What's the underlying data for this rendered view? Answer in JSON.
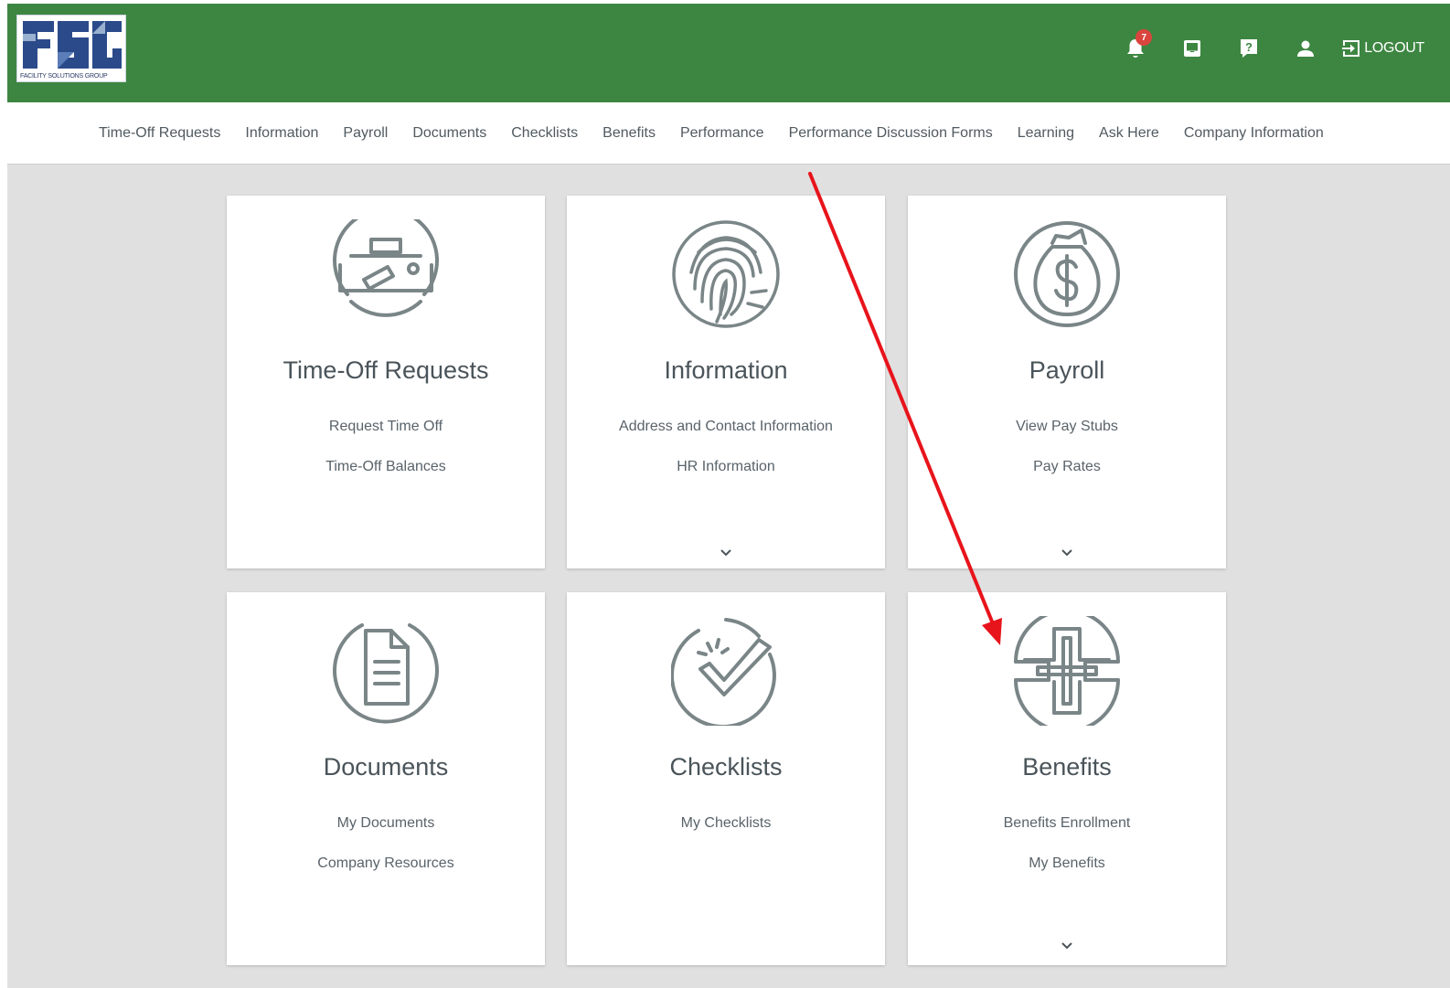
{
  "brand": {
    "logo_text": "FSG",
    "logo_caption": "FACILITY SOLUTIONS GROUP",
    "header_color": "#3d8641"
  },
  "header": {
    "notification_count": "7",
    "logout_label": "LOGOUT",
    "icons": [
      "bell-icon",
      "inbox-icon",
      "help-icon",
      "user-icon",
      "logout-icon"
    ]
  },
  "nav": {
    "items": [
      "Time-Off Requests",
      "Information",
      "Payroll",
      "Documents",
      "Checklists",
      "Benefits",
      "Performance",
      "Performance Discussion Forms",
      "Learning",
      "Ask Here",
      "Company Information"
    ]
  },
  "cards": [
    {
      "title": "Time-Off Requests",
      "icon": "briefcase-icon",
      "links": [
        "Request Time Off",
        "Time-Off Balances"
      ],
      "expandable": false
    },
    {
      "title": "Information",
      "icon": "fingerprint-icon",
      "links": [
        "Address and Contact Information",
        "HR Information"
      ],
      "expandable": true
    },
    {
      "title": "Payroll",
      "icon": "money-bag-icon",
      "links": [
        "View Pay Stubs",
        "Pay Rates"
      ],
      "expandable": true
    },
    {
      "title": "Documents",
      "icon": "document-icon",
      "links": [
        "My Documents",
        "Company Resources"
      ],
      "expandable": false
    },
    {
      "title": "Checklists",
      "icon": "checkmark-icon",
      "links": [
        "My Checklists"
      ],
      "expandable": false
    },
    {
      "title": "Benefits",
      "icon": "medical-cross-icon",
      "links": [
        "Benefits Enrollment",
        "My Benefits"
      ],
      "expandable": true
    }
  ],
  "annotation": {
    "type": "red-arrow",
    "from": "nav-benefits",
    "to": "benefits-card",
    "color": "#e8141b"
  }
}
